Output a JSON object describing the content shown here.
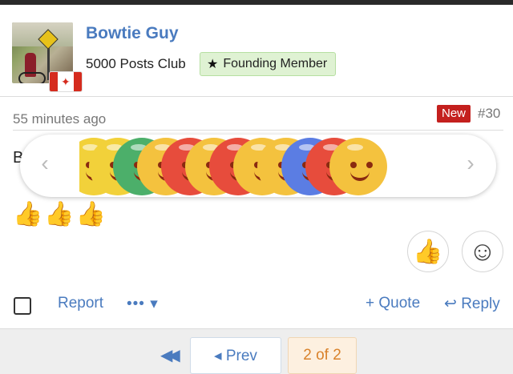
{
  "post": {
    "username": "Bowtie Guy",
    "rank": "5000 Posts Club",
    "badge_label": "Founding Member",
    "time": "55 minutes ago",
    "new_label": "New",
    "post_number": "#30",
    "body_letter": "B",
    "thumbs": "👍👍👍"
  },
  "reactions": {
    "prev_icon": "chevron-left-icon",
    "next_icon": "chevron-right-icon",
    "colors": [
      "#f2d13a",
      "#f2d13a",
      "#4caf6a",
      "#f4c23e",
      "#e74c3c",
      "#f4c23e",
      "#e74c3c",
      "#f4c23e",
      "#f4c23e",
      "#5b7de3",
      "#e74c3c",
      "#f4c23e"
    ]
  },
  "actions": {
    "report": "Report",
    "more": "••• ▾",
    "quote": "+ Quote",
    "reply": "↩ Reply"
  },
  "pager": {
    "first": "◀◀",
    "prev": "◂ Prev",
    "current": "2 of 2"
  },
  "colors": {
    "link": "#4a7bbf",
    "new_badge": "#c4201e",
    "founding_bg": "#dff2d3"
  }
}
